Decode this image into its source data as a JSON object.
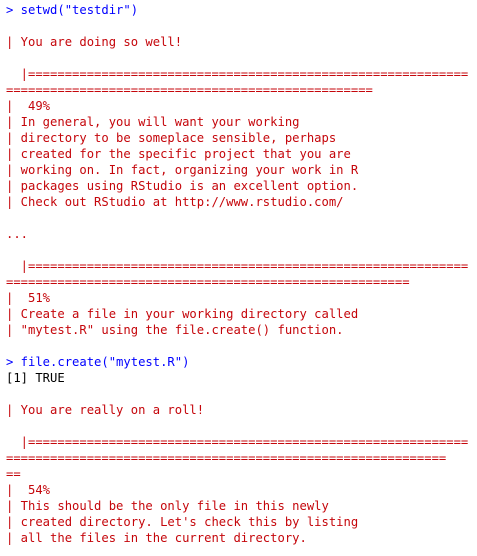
{
  "console": {
    "lines": [
      {
        "kind": "cmd",
        "text": "> setwd(\"testdir\")"
      },
      {
        "kind": "blank",
        "text": ""
      },
      {
        "kind": "msg",
        "text": "| You are doing so well!"
      },
      {
        "kind": "blank",
        "text": ""
      },
      {
        "kind": "msg",
        "text": "  |============================================================"
      },
      {
        "kind": "msg",
        "text": "=================================================="
      },
      {
        "kind": "msg",
        "text": "|  49%"
      },
      {
        "kind": "msg",
        "text": "| In general, you will want your working"
      },
      {
        "kind": "msg",
        "text": "| directory to be someplace sensible, perhaps"
      },
      {
        "kind": "msg",
        "text": "| created for the specific project that you are"
      },
      {
        "kind": "msg",
        "text": "| working on. In fact, organizing your work in R"
      },
      {
        "kind": "msg",
        "text": "| packages using RStudio is an excellent option."
      },
      {
        "kind": "msg",
        "text": "| Check out RStudio at http://www.rstudio.com/"
      },
      {
        "kind": "blank",
        "text": ""
      },
      {
        "kind": "msg",
        "text": "..."
      },
      {
        "kind": "blank",
        "text": ""
      },
      {
        "kind": "msg",
        "text": "  |============================================================"
      },
      {
        "kind": "msg",
        "text": "======================================================="
      },
      {
        "kind": "msg",
        "text": "|  51%"
      },
      {
        "kind": "msg",
        "text": "| Create a file in your working directory called"
      },
      {
        "kind": "msg",
        "text": "| \"mytest.R\" using the file.create() function."
      },
      {
        "kind": "blank",
        "text": ""
      },
      {
        "kind": "cmd",
        "text": "> file.create(\"mytest.R\")"
      },
      {
        "kind": "out",
        "text": "[1] TRUE"
      },
      {
        "kind": "blank",
        "text": ""
      },
      {
        "kind": "msg",
        "text": "| You are really on a roll!"
      },
      {
        "kind": "blank",
        "text": ""
      },
      {
        "kind": "msg",
        "text": "  |============================================================"
      },
      {
        "kind": "msg",
        "text": "============================================================"
      },
      {
        "kind": "msg",
        "text": "=="
      },
      {
        "kind": "msg",
        "text": "|  54%"
      },
      {
        "kind": "msg",
        "text": "| This should be the only file in this newly"
      },
      {
        "kind": "msg",
        "text": "| created directory. Let's check this by listing"
      },
      {
        "kind": "msg",
        "text": "| all the files in the current directory."
      }
    ]
  },
  "colors": {
    "command": "#0000ff",
    "output": "#000000",
    "message": "#c5060b",
    "background": "#ffffff"
  }
}
